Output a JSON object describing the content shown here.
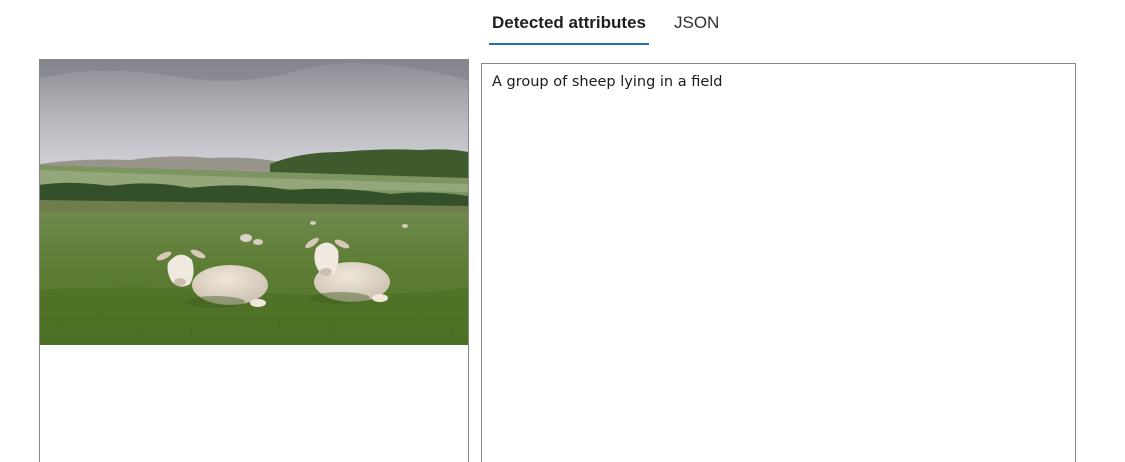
{
  "tabs": [
    {
      "label": "Detected attributes",
      "active": true
    },
    {
      "label": "JSON",
      "active": false
    }
  ],
  "image": {
    "subject": "two sheep lying in a green field with distant flock, hedgerows and hills under an overcast sky"
  },
  "result": {
    "caption": "A group of sheep lying in a field"
  },
  "colors": {
    "accent": "#1f6fb2",
    "panel_border": "#8a8886",
    "text": "#1b1b1b"
  }
}
